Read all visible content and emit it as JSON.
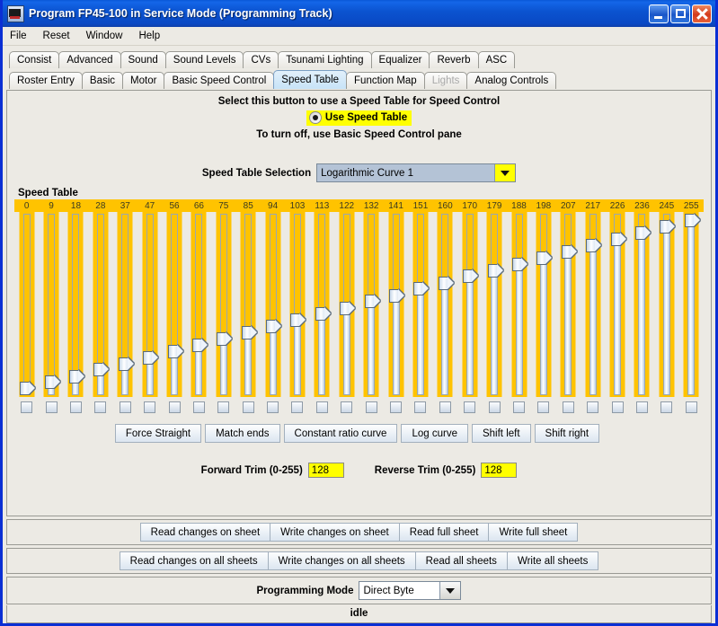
{
  "window": {
    "title": "Program FP45-100 in Service Mode (Programming Track)",
    "icon": "locomotive-icon",
    "minimize": "_",
    "maximize": "□",
    "close": "×"
  },
  "menu": [
    "File",
    "Reset",
    "Window",
    "Help"
  ],
  "tabs": {
    "row1": [
      {
        "label": "Consist",
        "selected": false,
        "disabled": false
      },
      {
        "label": "Advanced",
        "selected": false,
        "disabled": false
      },
      {
        "label": "Sound",
        "selected": false,
        "disabled": false
      },
      {
        "label": "Sound Levels",
        "selected": false,
        "disabled": false
      },
      {
        "label": "CVs",
        "selected": false,
        "disabled": false
      },
      {
        "label": "Tsunami Lighting",
        "selected": false,
        "disabled": false
      },
      {
        "label": "Equalizer",
        "selected": false,
        "disabled": false
      },
      {
        "label": "Reverb",
        "selected": false,
        "disabled": false
      },
      {
        "label": "ASC",
        "selected": false,
        "disabled": false
      }
    ],
    "row2": [
      {
        "label": "Roster Entry",
        "selected": false,
        "disabled": false
      },
      {
        "label": "Basic",
        "selected": false,
        "disabled": false
      },
      {
        "label": "Motor",
        "selected": false,
        "disabled": false
      },
      {
        "label": "Basic Speed Control",
        "selected": false,
        "disabled": false
      },
      {
        "label": "Speed Table",
        "selected": true,
        "disabled": false
      },
      {
        "label": "Function Map",
        "selected": false,
        "disabled": false
      },
      {
        "label": "Lights",
        "selected": false,
        "disabled": true
      },
      {
        "label": "Analog Controls",
        "selected": false,
        "disabled": false
      }
    ]
  },
  "header": {
    "instruction_top": "Select this button to use a Speed Table for Speed Control",
    "radio_label": "Use Speed Table",
    "instruction_bottom": "To turn off, use Basic Speed Control pane",
    "radio_selected": true,
    "highlight_color": "#ffff00"
  },
  "selection": {
    "label": "Speed Table Selection",
    "value": "Logarithmic Curve 1",
    "arrow_icon": "chevron-down-icon",
    "field_color": "#b4c3d6",
    "arrow_color": "#ffff00"
  },
  "speed_table": {
    "label": "Speed Table",
    "band_color": "#ffc300",
    "values": [
      0,
      9,
      18,
      28,
      37,
      47,
      56,
      66,
      75,
      85,
      94,
      103,
      113,
      122,
      132,
      141,
      151,
      160,
      170,
      179,
      188,
      198,
      207,
      217,
      226,
      236,
      245,
      255
    ],
    "max": 255,
    "checkbox_checked": [
      false,
      false,
      false,
      false,
      false,
      false,
      false,
      false,
      false,
      false,
      false,
      false,
      false,
      false,
      false,
      false,
      false,
      false,
      false,
      false,
      false,
      false,
      false,
      false,
      false,
      false,
      false,
      false
    ]
  },
  "curve_buttons": [
    "Force Straight",
    "Match ends",
    "Constant ratio curve",
    "Log curve",
    "Shift left",
    "Shift right"
  ],
  "trim": {
    "forward_label": "Forward Trim (0-255)",
    "forward_value": "128",
    "reverse_label": "Reverse Trim (0-255)",
    "reverse_value": "128"
  },
  "sheet_buttons": [
    "Read changes on sheet",
    "Write changes on sheet",
    "Read full sheet",
    "Write full sheet"
  ],
  "all_sheet_buttons": [
    "Read changes on all sheets",
    "Write changes on all sheets",
    "Read all sheets",
    "Write all sheets"
  ],
  "programming": {
    "label": "Programming Mode",
    "value": "Direct Byte",
    "arrow_icon": "chevron-down-icon"
  },
  "status": "idle"
}
